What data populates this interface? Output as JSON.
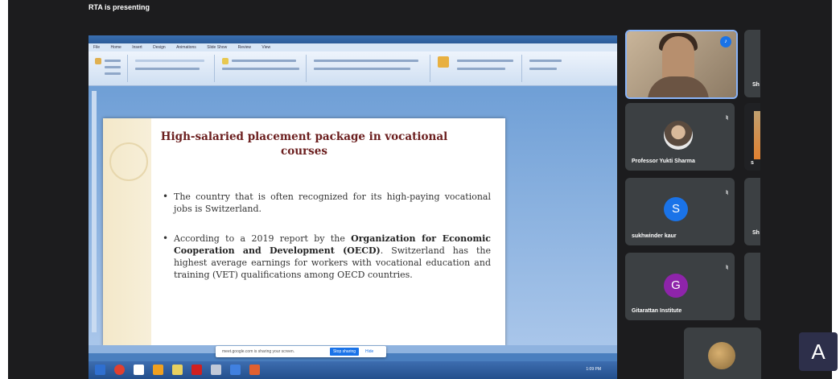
{
  "meeting": {
    "presenting_label": "RTA is presenting"
  },
  "screen": {
    "menu": [
      "File",
      "Home",
      "Insert",
      "Design",
      "Animations",
      "Slide Show",
      "Review",
      "View"
    ],
    "slide": {
      "title": "High-salaried placement package in vocational courses",
      "bullet1": "The country that is often recognized for its high-paying vocational jobs is Switzerland.",
      "bullet2_prefix": "According to a 2019 report by the ",
      "bullet2_bold": "Organization for Economic Cooperation and Development (OECD)",
      "bullet2_suffix": ". Switzerland has the highest average earnings for workers with vocational education and training (VET) qualifications among OECD countries."
    },
    "share_bar": {
      "message": "meet.google.com is sharing your screen.",
      "stop_label": "Stop sharing",
      "hide_label": "Hide"
    },
    "taskbar_time": "1:09 PM"
  },
  "participants": [
    {
      "name": "",
      "kind": "video",
      "speaking": true
    },
    {
      "name": "Sh",
      "kind": "blank"
    },
    {
      "name": "Professor Yukti Sharma",
      "kind": "photo",
      "muted": true
    },
    {
      "name": "s",
      "kind": "blank"
    },
    {
      "name": "sukhwinder kaur",
      "kind": "letter",
      "letter": "S",
      "color": "#1a73e8",
      "muted": true
    },
    {
      "name": "Sh",
      "kind": "blank"
    },
    {
      "name": "Gitarattan Institute",
      "kind": "letter",
      "letter": "G",
      "color": "#8e24aa",
      "muted": true
    }
  ],
  "colors": {
    "meet_bg": "#1c1c1e",
    "tile_bg": "#3c4043",
    "accent_blue": "#1a73e8",
    "slide_title": "#6b1e1e"
  }
}
